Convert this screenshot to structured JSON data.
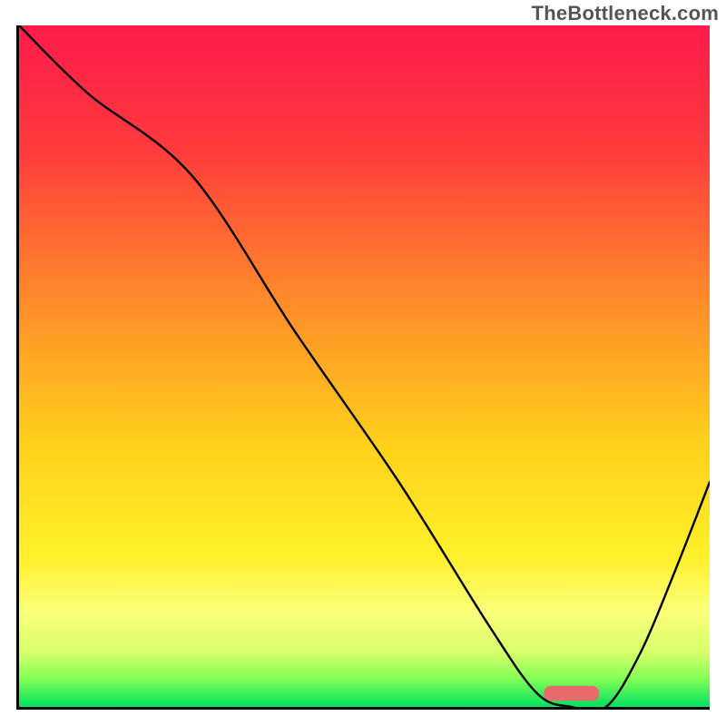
{
  "attribution": "TheBottleneck.com",
  "chart_data": {
    "type": "line",
    "title": "",
    "xlabel": "",
    "ylabel": "",
    "xlim": [
      0,
      100
    ],
    "ylim": [
      0,
      100
    ],
    "x": [
      0,
      10,
      25,
      40,
      55,
      68,
      75,
      80,
      85,
      90,
      95,
      100
    ],
    "values": [
      100,
      90,
      78,
      55,
      33,
      12,
      2,
      0,
      0,
      8,
      20,
      33
    ],
    "marker": {
      "x_start": 76,
      "x_end": 84,
      "y": 2
    },
    "gradient_stops": [
      {
        "pct": 0,
        "color": "#ff1b4b"
      },
      {
        "pct": 18,
        "color": "#ff3a3d"
      },
      {
        "pct": 40,
        "color": "#ff8a2a"
      },
      {
        "pct": 62,
        "color": "#ffd21a"
      },
      {
        "pct": 78,
        "color": "#fff02a"
      },
      {
        "pct": 86,
        "color": "#fbff7a"
      },
      {
        "pct": 92,
        "color": "#d7ff6a"
      },
      {
        "pct": 96,
        "color": "#7fff55"
      },
      {
        "pct": 100,
        "color": "#00e060"
      }
    ]
  }
}
